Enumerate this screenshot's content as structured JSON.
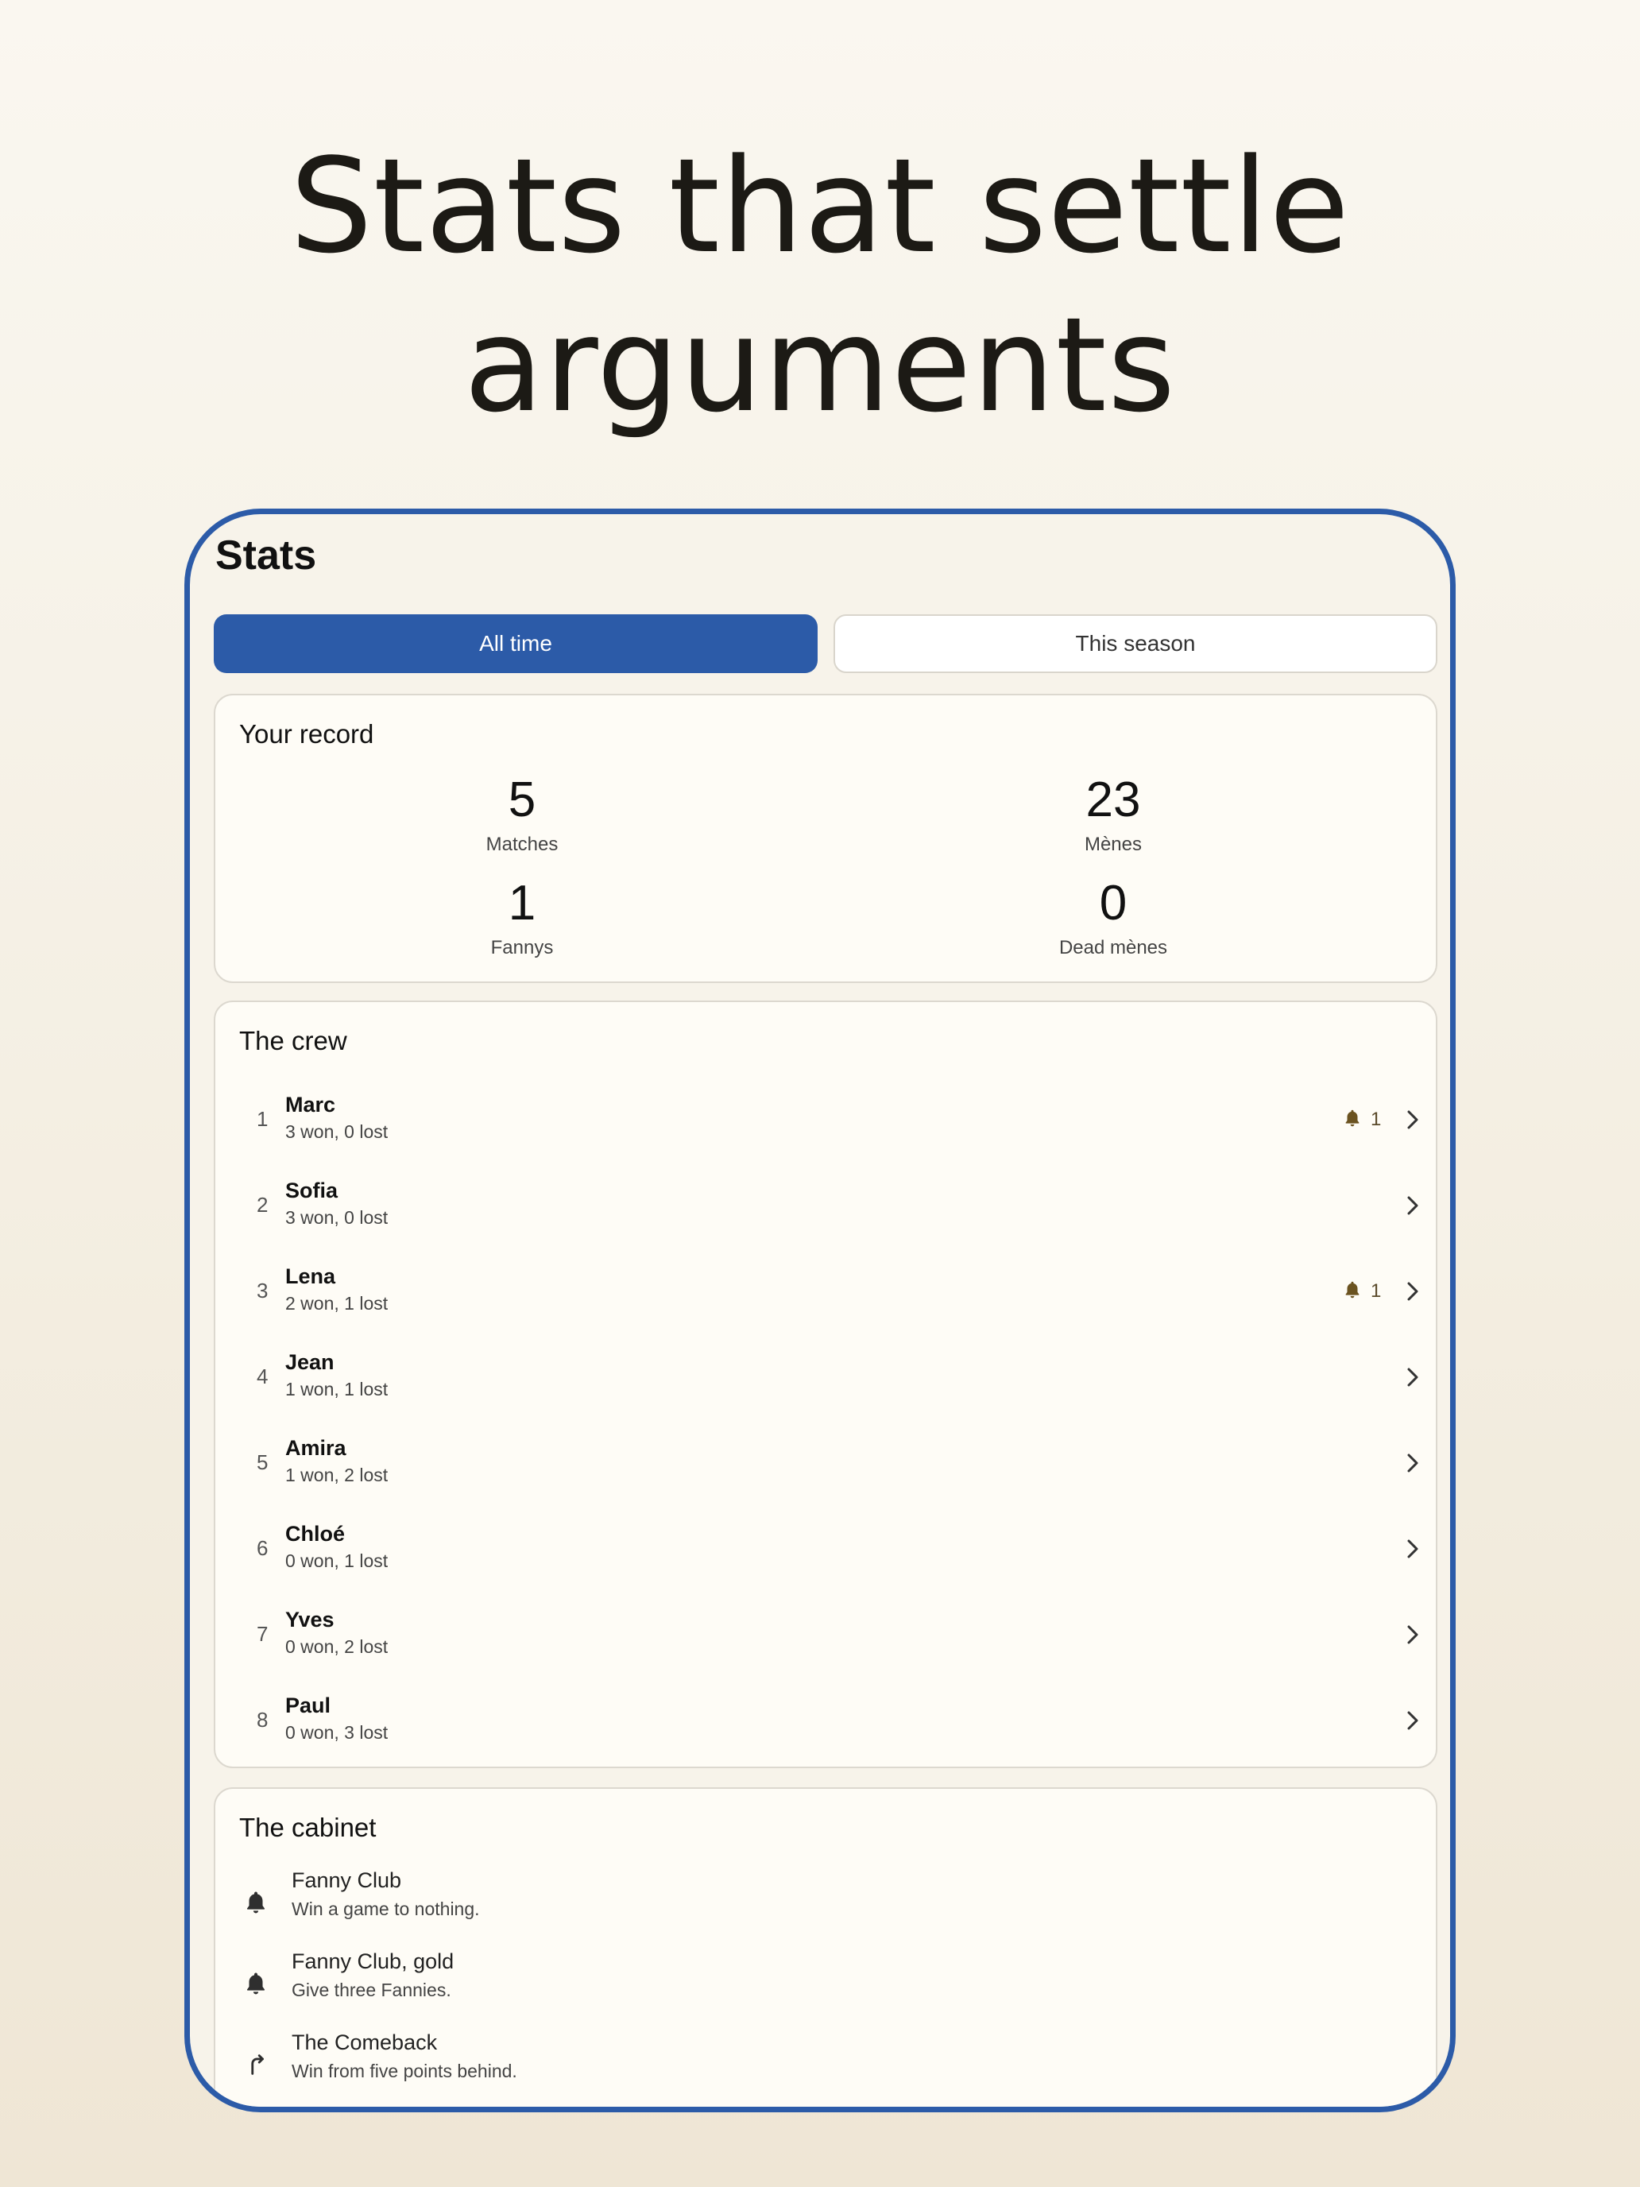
{
  "headline": {
    "line1": "Stats that settle",
    "line2": "arguments"
  },
  "screen": {
    "title": "Stats",
    "segments": {
      "all_time": "All time",
      "this_season": "This season"
    },
    "record": {
      "title": "Your record",
      "stats": [
        {
          "value": "5",
          "label": "Matches"
        },
        {
          "value": "23",
          "label": "Mènes"
        },
        {
          "value": "1",
          "label": "Fannys"
        },
        {
          "value": "0",
          "label": "Dead mènes"
        }
      ]
    },
    "crew": {
      "title": "The crew",
      "players": [
        {
          "rank": "1",
          "name": "Marc",
          "record": "3 won, 0 lost",
          "badge_count": "1"
        },
        {
          "rank": "2",
          "name": "Sofia",
          "record": "3 won, 0 lost",
          "badge_count": null
        },
        {
          "rank": "3",
          "name": "Lena",
          "record": "2 won, 1 lost",
          "badge_count": "1"
        },
        {
          "rank": "4",
          "name": "Jean",
          "record": "1 won, 1 lost",
          "badge_count": null
        },
        {
          "rank": "5",
          "name": "Amira",
          "record": "1 won, 2 lost",
          "badge_count": null
        },
        {
          "rank": "6",
          "name": "Chloé",
          "record": "0 won, 1 lost",
          "badge_count": null
        },
        {
          "rank": "7",
          "name": "Yves",
          "record": "0 won, 2 lost",
          "badge_count": null
        },
        {
          "rank": "8",
          "name": "Paul",
          "record": "0 won, 3 lost",
          "badge_count": null
        }
      ]
    },
    "cabinet": {
      "title": "The cabinet",
      "achievements": [
        {
          "icon": "bell-icon",
          "name": "Fanny Club",
          "desc": "Win a game to nothing."
        },
        {
          "icon": "bell-icon",
          "name": "Fanny Club, gold",
          "desc": "Give three Fannies."
        },
        {
          "icon": "comeback-arrow-icon",
          "name": "The Comeback",
          "desc": "Win from five points behind."
        }
      ]
    }
  },
  "colors": {
    "accent": "#2c5ba8",
    "badge": "#6b5320",
    "background": "#f6f1e6"
  }
}
